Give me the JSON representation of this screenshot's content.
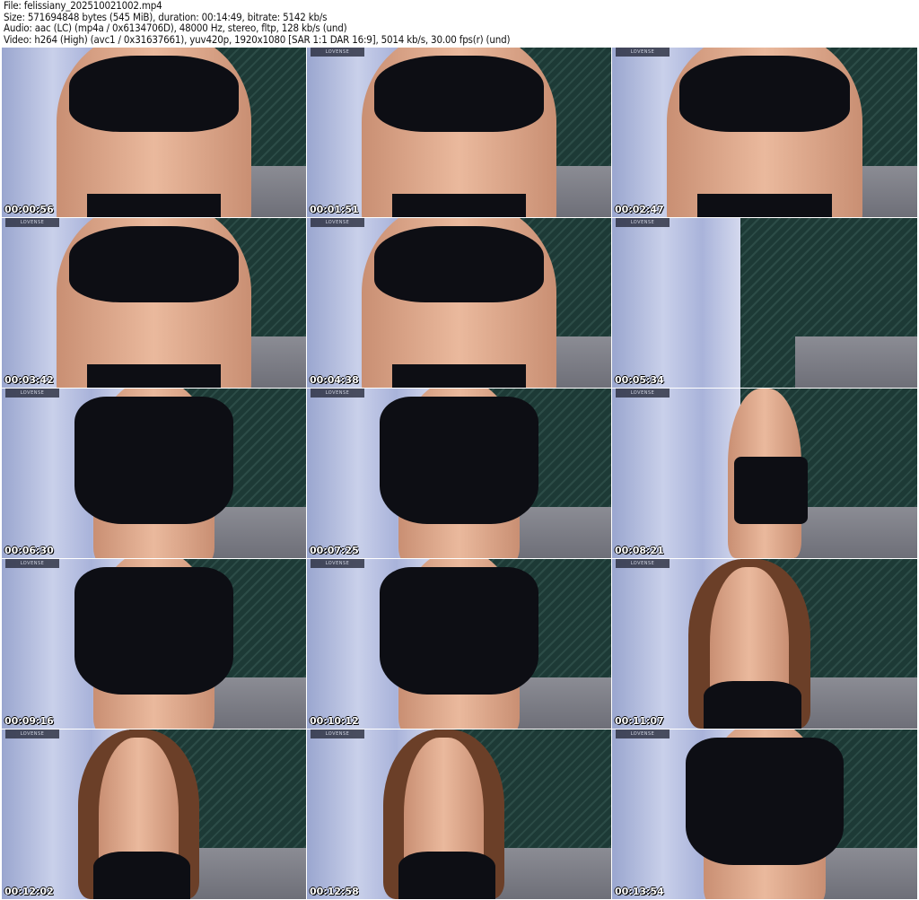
{
  "header": {
    "file": "File: felissiany_202510021002.mp4",
    "size": "Size: 571694848 bytes (545 MiB), duration: 00:14:49, bitrate: 5142 kb/s",
    "audio": "Audio: aac (LC) (mp4a / 0x6134706D), 48000 Hz, stereo, fltp, 128 kb/s (und)",
    "video": "Video: h264 (High) (avc1 / 0x31637661), yuv420p, 1920x1080 [SAR 1:1 DAR 16:9], 5014 kb/s, 30.00 fps(r) (und)"
  },
  "watermark": "LOVENSE",
  "thumbnails": [
    {
      "time": "00:00:56",
      "shot": "torso"
    },
    {
      "time": "00:01:51",
      "shot": "torso"
    },
    {
      "time": "00:02:47",
      "shot": "torso"
    },
    {
      "time": "00:03:42",
      "shot": "torso"
    },
    {
      "time": "00:04:38",
      "shot": "torso"
    },
    {
      "time": "00:05:34",
      "shot": "room"
    },
    {
      "time": "00:06:30",
      "shot": "skirt"
    },
    {
      "time": "00:07:25",
      "shot": "skirt"
    },
    {
      "time": "00:08:21",
      "shot": "full"
    },
    {
      "time": "00:09:16",
      "shot": "skirt"
    },
    {
      "time": "00:10:12",
      "shot": "skirt"
    },
    {
      "time": "00:11:07",
      "shot": "portrait"
    },
    {
      "time": "00:12:02",
      "shot": "portrait"
    },
    {
      "time": "00:12:58",
      "shot": "portrait"
    },
    {
      "time": "00:13:54",
      "shot": "skirt"
    }
  ]
}
